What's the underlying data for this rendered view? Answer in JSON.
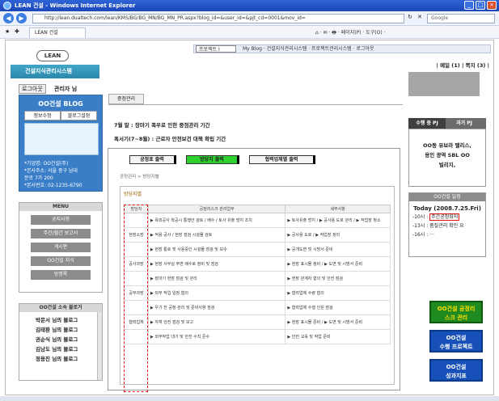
{
  "window": {
    "title": "LEAN 건설 - Windows Internet Explorer",
    "address": "http://lean.dualtech.com/lean/KMS/BG/BG_MN/BG_MN_PR.aspx?blog_id=&user_id=&pjt_cd=0001&mov_id=",
    "search_placeholder": "Google",
    "tab_label": "LEAN 건설",
    "tools_text": "⌂ · ✉ · 🖶 · 페이지(P) · 도구(O) ·"
  },
  "site": {
    "logo_text": "LEAN",
    "banner": "건설지식관리시스템",
    "topmenu_select": "프로젝트 I",
    "topmenu_path": "My Blog · 건설지식관리시스템 · 프로젝트관리시스템 · 로그아웃"
  },
  "login": {
    "logout_label": "로그아웃",
    "user_label": "관리자 님"
  },
  "blog": {
    "title": "OO건설 BLOG",
    "tab_edit": "정보수정",
    "tab_bloggers": "블로그설정",
    "info_lines": [
      "*기업명: OO건설(주)",
      "*본사주소: 서울 중구 남대",
      "문로 7가 200",
      "*본사번호: 02-1235-6790"
    ]
  },
  "menu": {
    "header": "MENU",
    "items": [
      "공지사항",
      "주간/월간 보고서",
      "게시판",
      "OO건설 지식",
      "방명록"
    ]
  },
  "blog_list": {
    "header": "OO건설 소속 블로거",
    "items": [
      "박문서 님의 블로그",
      "김태환 님의 블로그",
      "권순식 님의 블로그",
      "김남도 님의 블로그",
      "정용진 님의 블로그"
    ]
  },
  "center": {
    "tab_label": "중점관리",
    "notice_lines": [
      "7월 말 : 장마기 폭우로 인한 중점관리 기간",
      "혹서기(7~8월) : 근로자 안전보건 대책 확립 기간"
    ],
    "panel_buttons": [
      "공정표 출력",
      "방당지 출력",
      "협력업체별 출력"
    ],
    "breadcrumb": "공정관리 > 방당지별",
    "subtitle": "방당지별",
    "table_headers": [
      "방당지",
      "공정리스크 관리업무",
      "세부사항"
    ],
    "table_rows": [
      {
        "c0": "",
        "c1": "▶ 옥외공사 착공시 통행안 검토 / 배수 / 토사 유출 방지 조치",
        "c2": "▶ 토사유출 방지 / ▶ 공사용 도로 관리 / ▶ 작업장 청소"
      },
      {
        "c0": "현장소장",
        "c1": "▶ 적용 공사 / 현장 점검 시설물 검토",
        "c2": "▶ 공사용 도로 / ▶ 작업장 정리"
      },
      {
        "c0": "",
        "c1": "▶ 현장 통로 및 사용중인 시설물 점검 및 보수",
        "c2": "▶ 공개도면 및 시방서 준비"
      },
      {
        "c0": "공사과장",
        "c1": "▶ 현장 사무실 주변 배수로 정비 및 점검",
        "c2": "▶ 현장 표시물 정비 / ▶ 도면 및 시방서 준비"
      },
      {
        "c0": "",
        "c1": "▶ 장마기 현장 점검 및 관리",
        "c2": "▶ 현장 관계자 협의 및 안전 점검"
      },
      {
        "c0": "공무과장",
        "c1": "▶ 외부 작업 일정 협의",
        "c2": "▶ 협력업체 수량 협의"
      },
      {
        "c0": "",
        "c1": "▶ 우기 전 공정 관리 및 준비사항 점검",
        "c2": "▶ 협력업체 수행 인원 점검"
      },
      {
        "c0": "협력업체",
        "c1": "▶ 자체 안전 점검 및 보고",
        "c2": "▶ 현장 표시물 준비 / ▶ 도면 및 시방서 준비"
      },
      {
        "c0": "",
        "c1": "▶ 외부작업 대기 및 안전 수칙 준수",
        "c2": "▶ 안전 교육 및 작업 준비"
      }
    ]
  },
  "right": {
    "top_links": "| 메일 (1) | 쪽지 (3) |",
    "project_tabs": [
      "수행 중 PJ",
      "과거 PJ"
    ],
    "project_text": [
      "OO동 유보라 팰리스,",
      "용인 광역 SBL OO",
      "빌리지,"
    ],
    "schedule_header": "OO건설 일정",
    "today": "Today (2008.7.25.Fri)",
    "events": [
      "-10시 : 주간공정회의",
      "-13시 : 품질관리 확인 요",
      "-16시 : ···"
    ],
    "highlight_event": "주간공정회의",
    "btn_green": [
      "OO건설 공정리",
      "스크 관리"
    ],
    "btn_blue1": [
      "OO건설",
      "수행 프로젝트"
    ],
    "btn_blue2": [
      "OO건설",
      "성과지표"
    ]
  },
  "colors": {
    "titlebar": "#1c47b9",
    "blog_box": "#3a7ec8",
    "active_button": "#2ed12e",
    "highlight_border": "#e01010",
    "green_btn": "#1f8a1f",
    "blue_btn": "#1650b8"
  }
}
